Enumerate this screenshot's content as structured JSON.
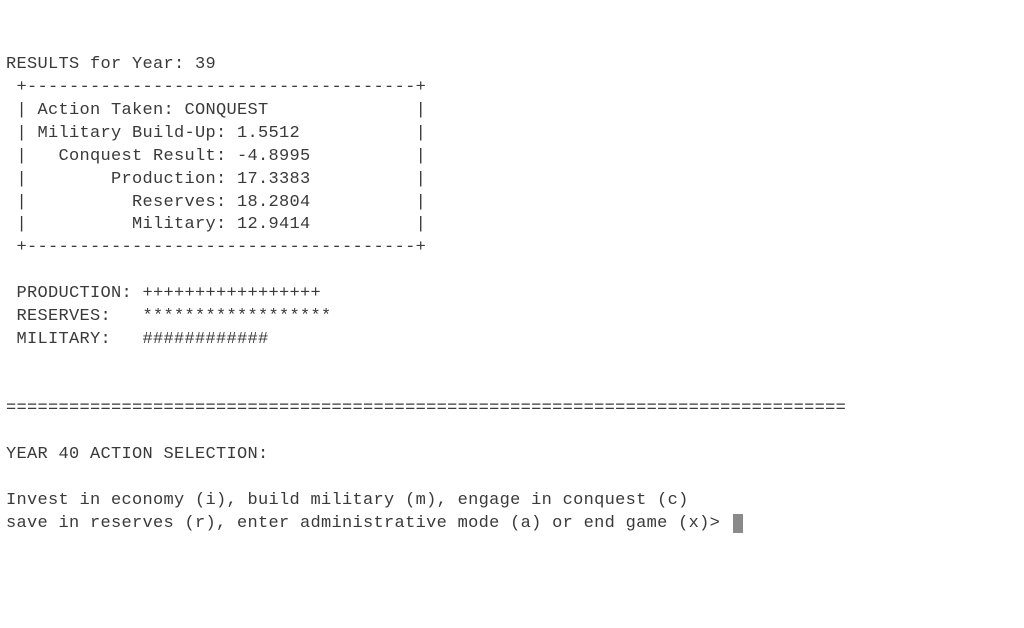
{
  "results": {
    "header_prefix": "RESULTS for Year: ",
    "year": "39",
    "box_top": " +-------------------------------------+",
    "rows": [
      {
        "label": "Action Taken",
        "value": "CONQUEST",
        "line": " | Action Taken: CONQUEST              |"
      },
      {
        "label": "Military Build-Up",
        "value": "1.5512",
        "line": " | Military Build-Up: 1.5512           |"
      },
      {
        "label": "Conquest Result",
        "value": "-4.8995",
        "line": " |   Conquest Result: -4.8995          |"
      },
      {
        "label": "Production",
        "value": "17.3383",
        "line": " |        Production: 17.3383          |"
      },
      {
        "label": "Reserves",
        "value": "18.2804",
        "line": " |          Reserves: 18.2804          |"
      },
      {
        "label": "Military",
        "value": "12.9414",
        "line": " |          Military: 12.9414          |"
      }
    ],
    "box_bottom": " +-------------------------------------+"
  },
  "bars": {
    "production": {
      "label": " PRODUCTION: ",
      "bar": "+++++++++++++++++"
    },
    "reserves": {
      "label": " RESERVES:   ",
      "bar": "******************"
    },
    "military": {
      "label": " MILITARY:   ",
      "bar": "############"
    }
  },
  "divider": "================================================================================",
  "action_selection": {
    "header_prefix": "YEAR ",
    "year": "40",
    "header_suffix": " ACTION SELECTION:",
    "line1": "Invest in economy (i), build military (m), engage in conquest (c)",
    "line2": "save in reserves (r), enter administrative mode (a) or end game (x)> "
  }
}
